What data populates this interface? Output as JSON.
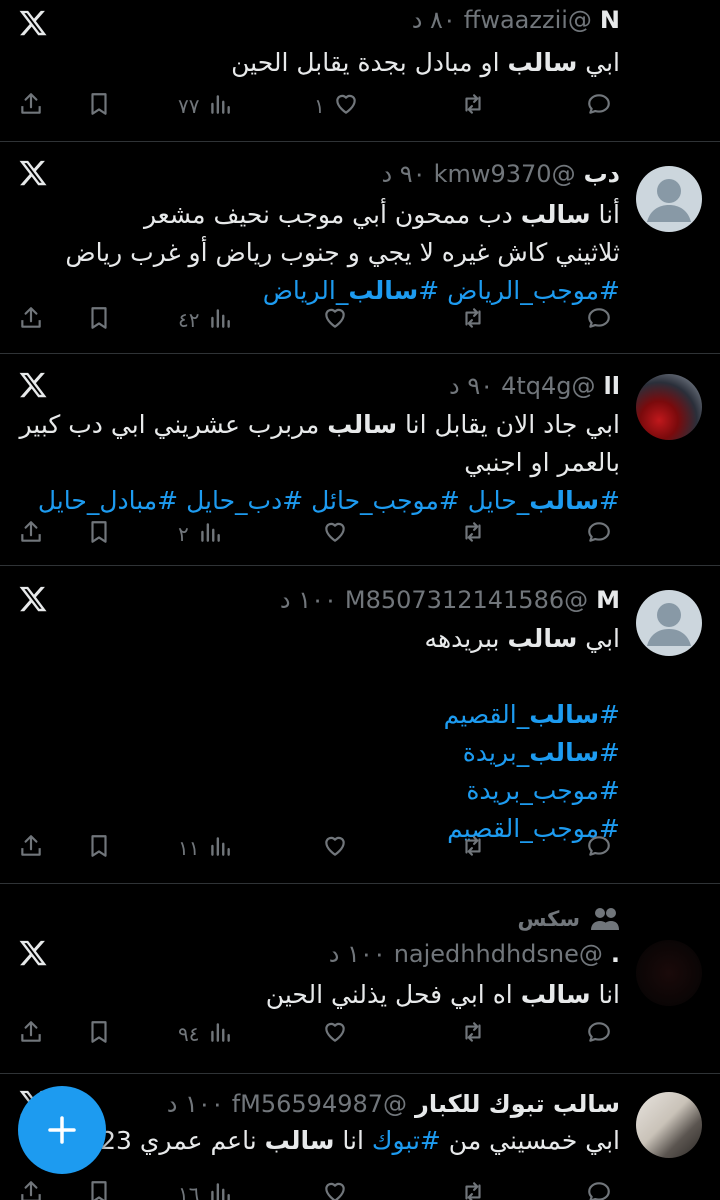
{
  "tweets": [
    {
      "name": "N",
      "handle": "@ffwaazzii",
      "time": "٨٠ د",
      "lines": [
        [
          {
            "t": "ابي "
          },
          {
            "t": "سالب",
            "b": true
          },
          {
            "t": " او مبادل بجدة يقابل الحين"
          }
        ]
      ],
      "views": "٧٧",
      "likes": "١",
      "avatar": "none"
    },
    {
      "name": "دب",
      "handle": "@kmw9370",
      "time": "٩٠ د",
      "lines": [
        [
          {
            "t": "أنا "
          },
          {
            "t": "سالب",
            "b": true
          },
          {
            "t": " دب ممحون أبي موجب نحيف مشعر"
          }
        ],
        [
          {
            "t": "ثلاثيني كاش غيره لا يجي و جنوب رياض أو غرب رياض"
          }
        ],
        [
          {
            "t": "#موجب_الرياض ",
            "tag": true
          },
          {
            "t": "#",
            "tag": true
          },
          {
            "t": "سالب",
            "tag": true,
            "b": true
          },
          {
            "t": "_الرياض",
            "tag": true
          }
        ]
      ],
      "views": "٤٢",
      "likes": "",
      "avatar": "default"
    },
    {
      "name": "اا",
      "handle": "@4tq4g",
      "time": "٩٠ د",
      "lines": [
        [
          {
            "t": "ابي جاد الان يقابل انا "
          },
          {
            "t": "سالب",
            "b": true
          },
          {
            "t": " مربرب عشريني ابي دب كبير"
          }
        ],
        [
          {
            "t": "بالعمر او اجنبي"
          }
        ],
        [
          {
            "t": "#",
            "tag": true
          },
          {
            "t": "سالب",
            "tag": true,
            "b": true
          },
          {
            "t": "_حايل #موجب_حائل #دب_حايل #مبادل_حايل",
            "tag": true
          }
        ]
      ],
      "views": "٢",
      "likes": "",
      "avatar": "flower"
    },
    {
      "name": "M",
      "handle": "@M8507312141586",
      "time": "١٠٠ د",
      "lines": [
        [
          {
            "t": "ابي "
          },
          {
            "t": "سالب",
            "b": true
          },
          {
            "t": " ببريدهه"
          }
        ],
        [],
        [
          {
            "t": "#",
            "tag": true
          },
          {
            "t": "سالب",
            "tag": true,
            "b": true
          },
          {
            "t": "_القصيم",
            "tag": true
          }
        ],
        [
          {
            "t": "#",
            "tag": true
          },
          {
            "t": "سالب",
            "tag": true,
            "b": true
          },
          {
            "t": "_بريدة",
            "tag": true
          }
        ],
        [
          {
            "t": "#موجب_بريدة",
            "tag": true
          }
        ],
        [
          {
            "t": "#موجب_القصيم",
            "tag": true
          }
        ]
      ],
      "views": "١١",
      "likes": "",
      "avatar": "default"
    },
    {
      "social": "سكس",
      "name": ".",
      "handle": "@najedhhdhdsne",
      "time": "١٠٠ د",
      "lines": [
        [
          {
            "t": "انا "
          },
          {
            "t": "سالب",
            "b": true
          },
          {
            "t": " اه ابي فحل يذلني الحين"
          }
        ]
      ],
      "views": "٩٤",
      "likes": "",
      "avatar": "dark"
    },
    {
      "name": "سالب تبوك للكبار",
      "handle": "@fM56594987",
      "time": "١٠٠ د",
      "lines": [
        [
          {
            "t": "ابي خمسيني من "
          },
          {
            "t": "#تبوك",
            "tag": true
          },
          {
            "t": " انا "
          },
          {
            "t": "سالب",
            "b": true
          },
          {
            "t": " ناعم عمري 23 عنـ"
          }
        ]
      ],
      "views": "١٦",
      "likes": "",
      "avatar": "photo"
    }
  ],
  "icons": {
    "x_logo": "x-logo-icon",
    "share": "share-icon",
    "bookmark": "bookmark-icon",
    "views": "views-icon",
    "like": "heart-icon",
    "retweet": "retweet-icon",
    "reply": "reply-icon",
    "fab": "plus-icon",
    "social": "people-icon"
  },
  "colors": {
    "background": "#000000",
    "accent": "#1d9bf0",
    "muted": "#71767b",
    "text": "#e7e9ea",
    "divider": "#2f3336"
  }
}
